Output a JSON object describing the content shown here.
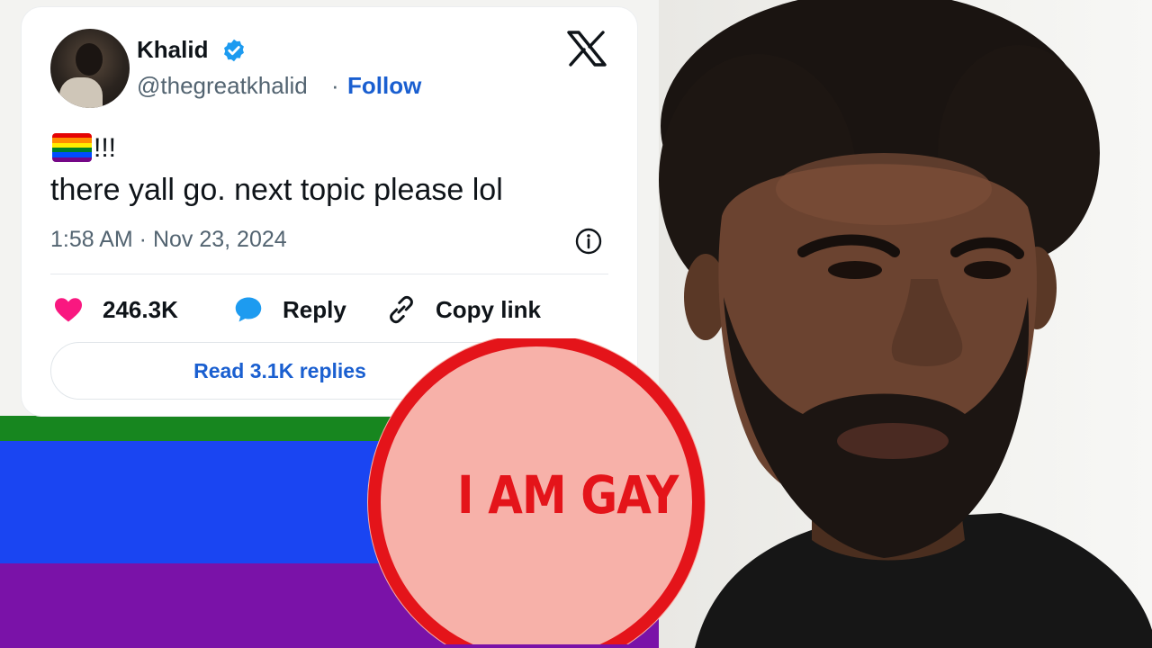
{
  "tweet": {
    "display_name": "Khalid",
    "handle": "@thegreatkhalid",
    "separator": "·",
    "follow_label": "Follow",
    "emoji_suffix": "!!!",
    "text": "there yall go. next topic please lol",
    "timestamp": "1:58 AM · Nov 23, 2024",
    "actions": {
      "likes": "246.3K",
      "reply": "Reply",
      "copy_link": "Copy link"
    },
    "read_replies": "Read 3.1K replies"
  },
  "overlay": {
    "badge_text": "I AM GAY"
  },
  "icons": {
    "platform": "x-logo-icon",
    "verified": "verified-badge-icon",
    "info": "info-icon",
    "like": "heart-icon",
    "reply": "speech-bubble-icon",
    "copy": "link-icon",
    "emoji": "rainbow-flag-icon"
  },
  "colors": {
    "verified": "#1d9bf0",
    "link": "#1a5fd0",
    "heart": "#f91880",
    "reply_bubble": "#1d9bf0",
    "badge_ring": "#e4141a",
    "badge_fill": "#f7b1a9",
    "flag_green": "#17861f",
    "flag_blue": "#1a45f2",
    "flag_purple": "#7a12a8"
  }
}
